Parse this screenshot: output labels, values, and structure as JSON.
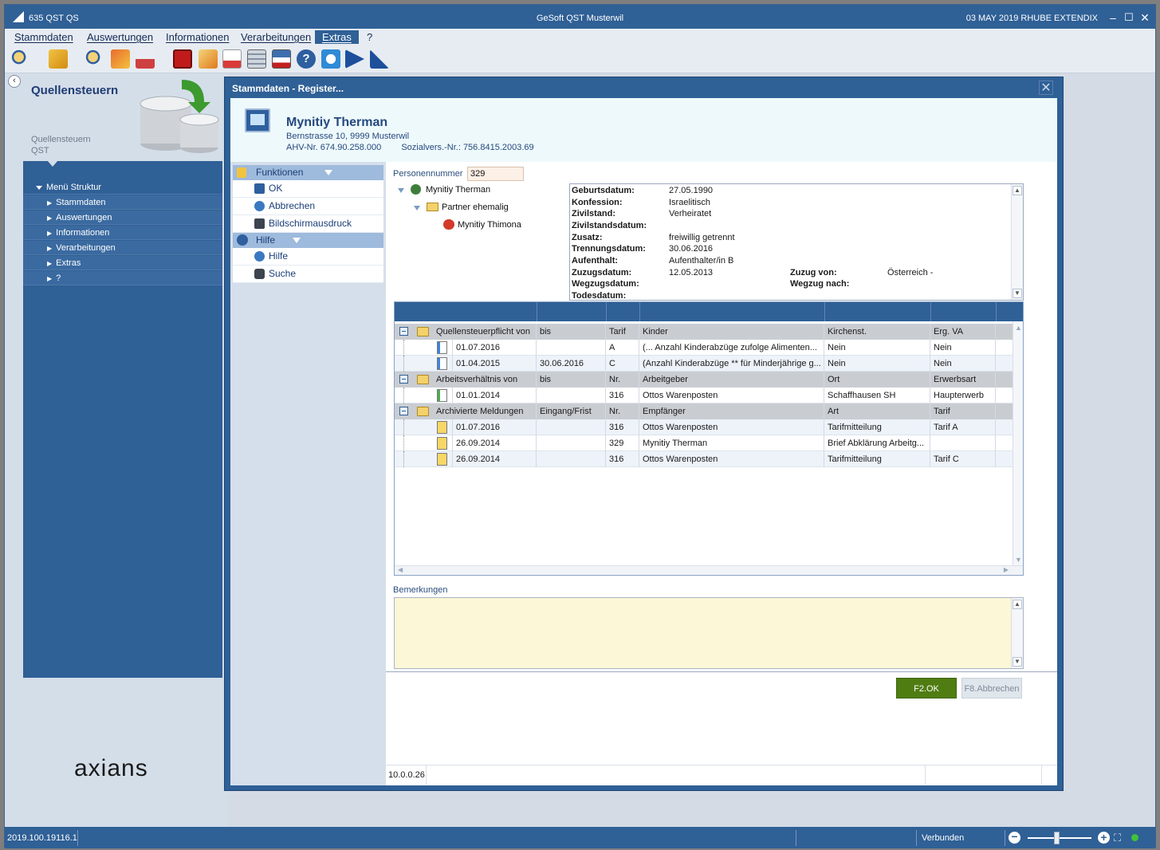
{
  "window": {
    "app_id": "635  QST  QS",
    "title": "GeSoft QST Musterwil",
    "right_info": "03 MAY 2019  RHUBE  EXTENDIX"
  },
  "menu": [
    "Stammdaten",
    "Auswertungen",
    "Informationen",
    "Verarbeitungen",
    "Extras",
    "?"
  ],
  "left_panel": {
    "title": "Quellensteuern",
    "sub1": "Quellensteuern",
    "sub2": "QST",
    "nav_root": "Menü Struktur",
    "nav_items": [
      "Stammdaten",
      "Auswertungen",
      "Informationen",
      "Verarbeitungen",
      "Extras",
      "?"
    ],
    "brand": "axians"
  },
  "dialog": {
    "title": "Stammdaten - Register..."
  },
  "person": {
    "name": "Mynitiy Therman",
    "address": "Bernstrasse 10, 9999 Musterwil",
    "ahv": "AHV-Nr. 674.90.258.000",
    "sozial": "Sozialvers.-Nr.: 756.8415.2003.69"
  },
  "side_menu": {
    "funktionen": "Funktionen",
    "ok": "OK",
    "abbrechen": "Abbrechen",
    "print": "Bildschirmausdruck",
    "hilfe_head": "Hilfe",
    "hilfe": "Hilfe",
    "suche": "Suche"
  },
  "form": {
    "personennummer_label": "Personennummer",
    "personennummer": "329",
    "tree": {
      "root": "Mynitiy Therman",
      "partner": "Partner ehemalig",
      "child": "Mynitiy Thimona"
    },
    "info": {
      "geburt_l": "Geburtsdatum:",
      "geburt": "27.05.1990",
      "konf_l": "Konfession:",
      "konf": "Israelitisch",
      "zivil_l": "Zivilstand:",
      "zivil": "Verheiratet",
      "zivild_l": "Zivilstandsdatum:",
      "zusatz_l": "Zusatz:",
      "zusatz": "freiwillig getrennt",
      "trenn_l": "Trennungsdatum:",
      "trenn": "30.06.2016",
      "aufent_l": "Aufenthalt:",
      "aufent": "Aufenthalter/in B",
      "zuzugd_l": "Zuzugsdatum:",
      "zuzugd": "12.05.2013",
      "zuzugv_l": "Zuzug von:",
      "zuzugv": "Österreich -",
      "wegzugd_l": "Wegzugsdatum:",
      "wegzugn_l": "Wegzug nach:",
      "tod_l": "Todesdatum:"
    },
    "bemerkungen_label": "Bemerkungen",
    "btn_ok": "F2.OK",
    "btn_cancel": "F8.Abbrechen",
    "version": "10.0.0.26"
  },
  "grid": {
    "groups": [
      {
        "cols": [
          "Quellensteuerpflicht von",
          "bis",
          "Tarif",
          "Kinder",
          "Kirchenst.",
          "Erg. VA"
        ],
        "rows": [
          [
            "01.07.2016",
            "",
            "A",
            "(... Anzahl Kinderabzüge zufolge Alimenten...",
            "Nein",
            "Nein"
          ],
          [
            "01.04.2015",
            "30.06.2016",
            "C",
            "(Anzahl Kinderabzüge ** für Minderjährige g...",
            "Nein",
            "Nein"
          ]
        ]
      },
      {
        "cols": [
          "Arbeitsverhältnis von",
          "bis",
          "Nr.",
          "Arbeitgeber",
          "Ort",
          "Erwerbsart"
        ],
        "rows": [
          [
            "01.01.2014",
            "",
            "316",
            "Ottos Warenposten",
            "Schaffhausen SH",
            "Haupterwerb"
          ]
        ]
      },
      {
        "cols": [
          "Archivierte Meldungen",
          "Eingang/Frist",
          "Nr.",
          "Empfänger",
          "Art",
          "Tarif"
        ],
        "rows": [
          [
            "01.07.2016",
            "",
            "316",
            "Ottos Warenposten",
            "Tarifmitteilung",
            "Tarif A"
          ],
          [
            "26.09.2014",
            "",
            "329",
            "Mynitiy Therman",
            "Brief Abklärung Arbeitg...",
            ""
          ],
          [
            "26.09.2014",
            "",
            "316",
            "Ottos Warenposten",
            "Tarifmitteilung",
            "Tarif C"
          ]
        ]
      }
    ]
  },
  "status": {
    "version": "2019.100.19116.1",
    "connection": "Verbunden"
  },
  "colors": {
    "primary": "#2f6096",
    "ok_button": "#4f7d12",
    "notes_bg": "#fcf7d6"
  }
}
